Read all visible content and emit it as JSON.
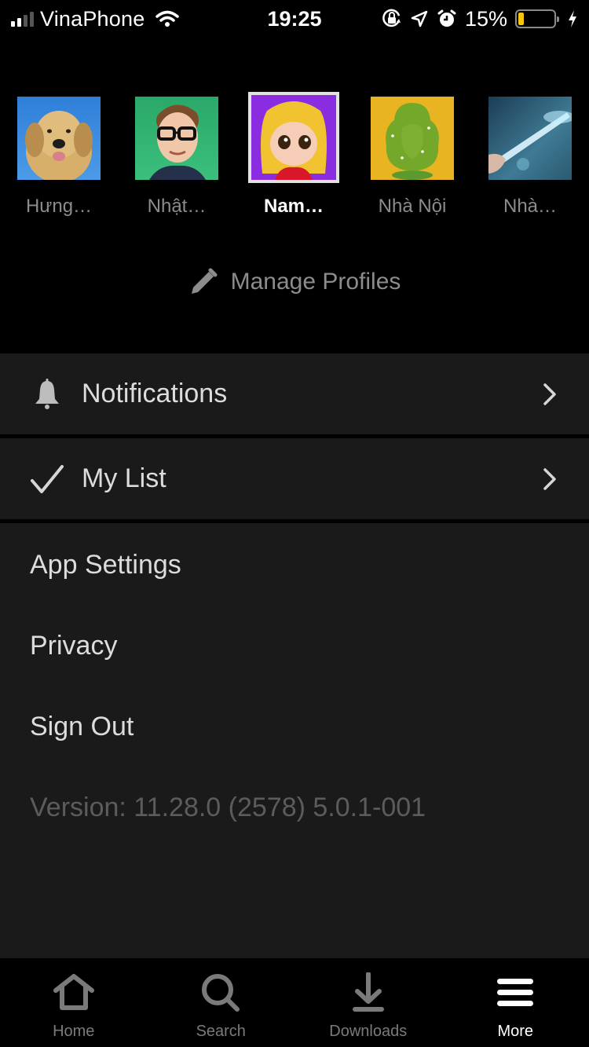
{
  "status_bar": {
    "carrier": "VinaPhone",
    "time": "19:25",
    "battery_percent_label": "15%",
    "battery_level": 0.15,
    "battery_color": "#f6c409",
    "icons": [
      "signal-icon",
      "wifi-icon",
      "orientation-lock-icon",
      "location-icon",
      "alarm-icon",
      "battery-icon",
      "charging-icon"
    ]
  },
  "profiles": [
    {
      "name": "Hưng…",
      "avatar": "golden-retriever-dog",
      "active": false
    },
    {
      "name": "Nhật…",
      "avatar": "man-with-glasses",
      "active": false
    },
    {
      "name": "Nam…",
      "avatar": "blonde-doll-girl",
      "active": true
    },
    {
      "name": "Nhà Nội",
      "avatar": "green-tree",
      "active": false
    },
    {
      "name": "Nhà…",
      "avatar": "light-beam",
      "active": false
    }
  ],
  "manage_profiles": {
    "label": "Manage Profiles",
    "icon": "pencil-icon"
  },
  "menu": {
    "nav_rows": [
      {
        "label": "Notifications",
        "icon": "bell-icon"
      },
      {
        "label": "My List",
        "icon": "checkmark-icon"
      }
    ],
    "items": [
      {
        "label": "App Settings"
      },
      {
        "label": "Privacy"
      },
      {
        "label": "Sign Out"
      }
    ],
    "version": "Version: 11.28.0 (2578) 5.0.1-001"
  },
  "tab_bar": {
    "tabs": [
      {
        "label": "Home",
        "icon": "home-icon",
        "active": false
      },
      {
        "label": "Search",
        "icon": "search-icon",
        "active": false
      },
      {
        "label": "Downloads",
        "icon": "download-icon",
        "active": false
      },
      {
        "label": "More",
        "icon": "menu-icon",
        "active": true
      }
    ]
  }
}
